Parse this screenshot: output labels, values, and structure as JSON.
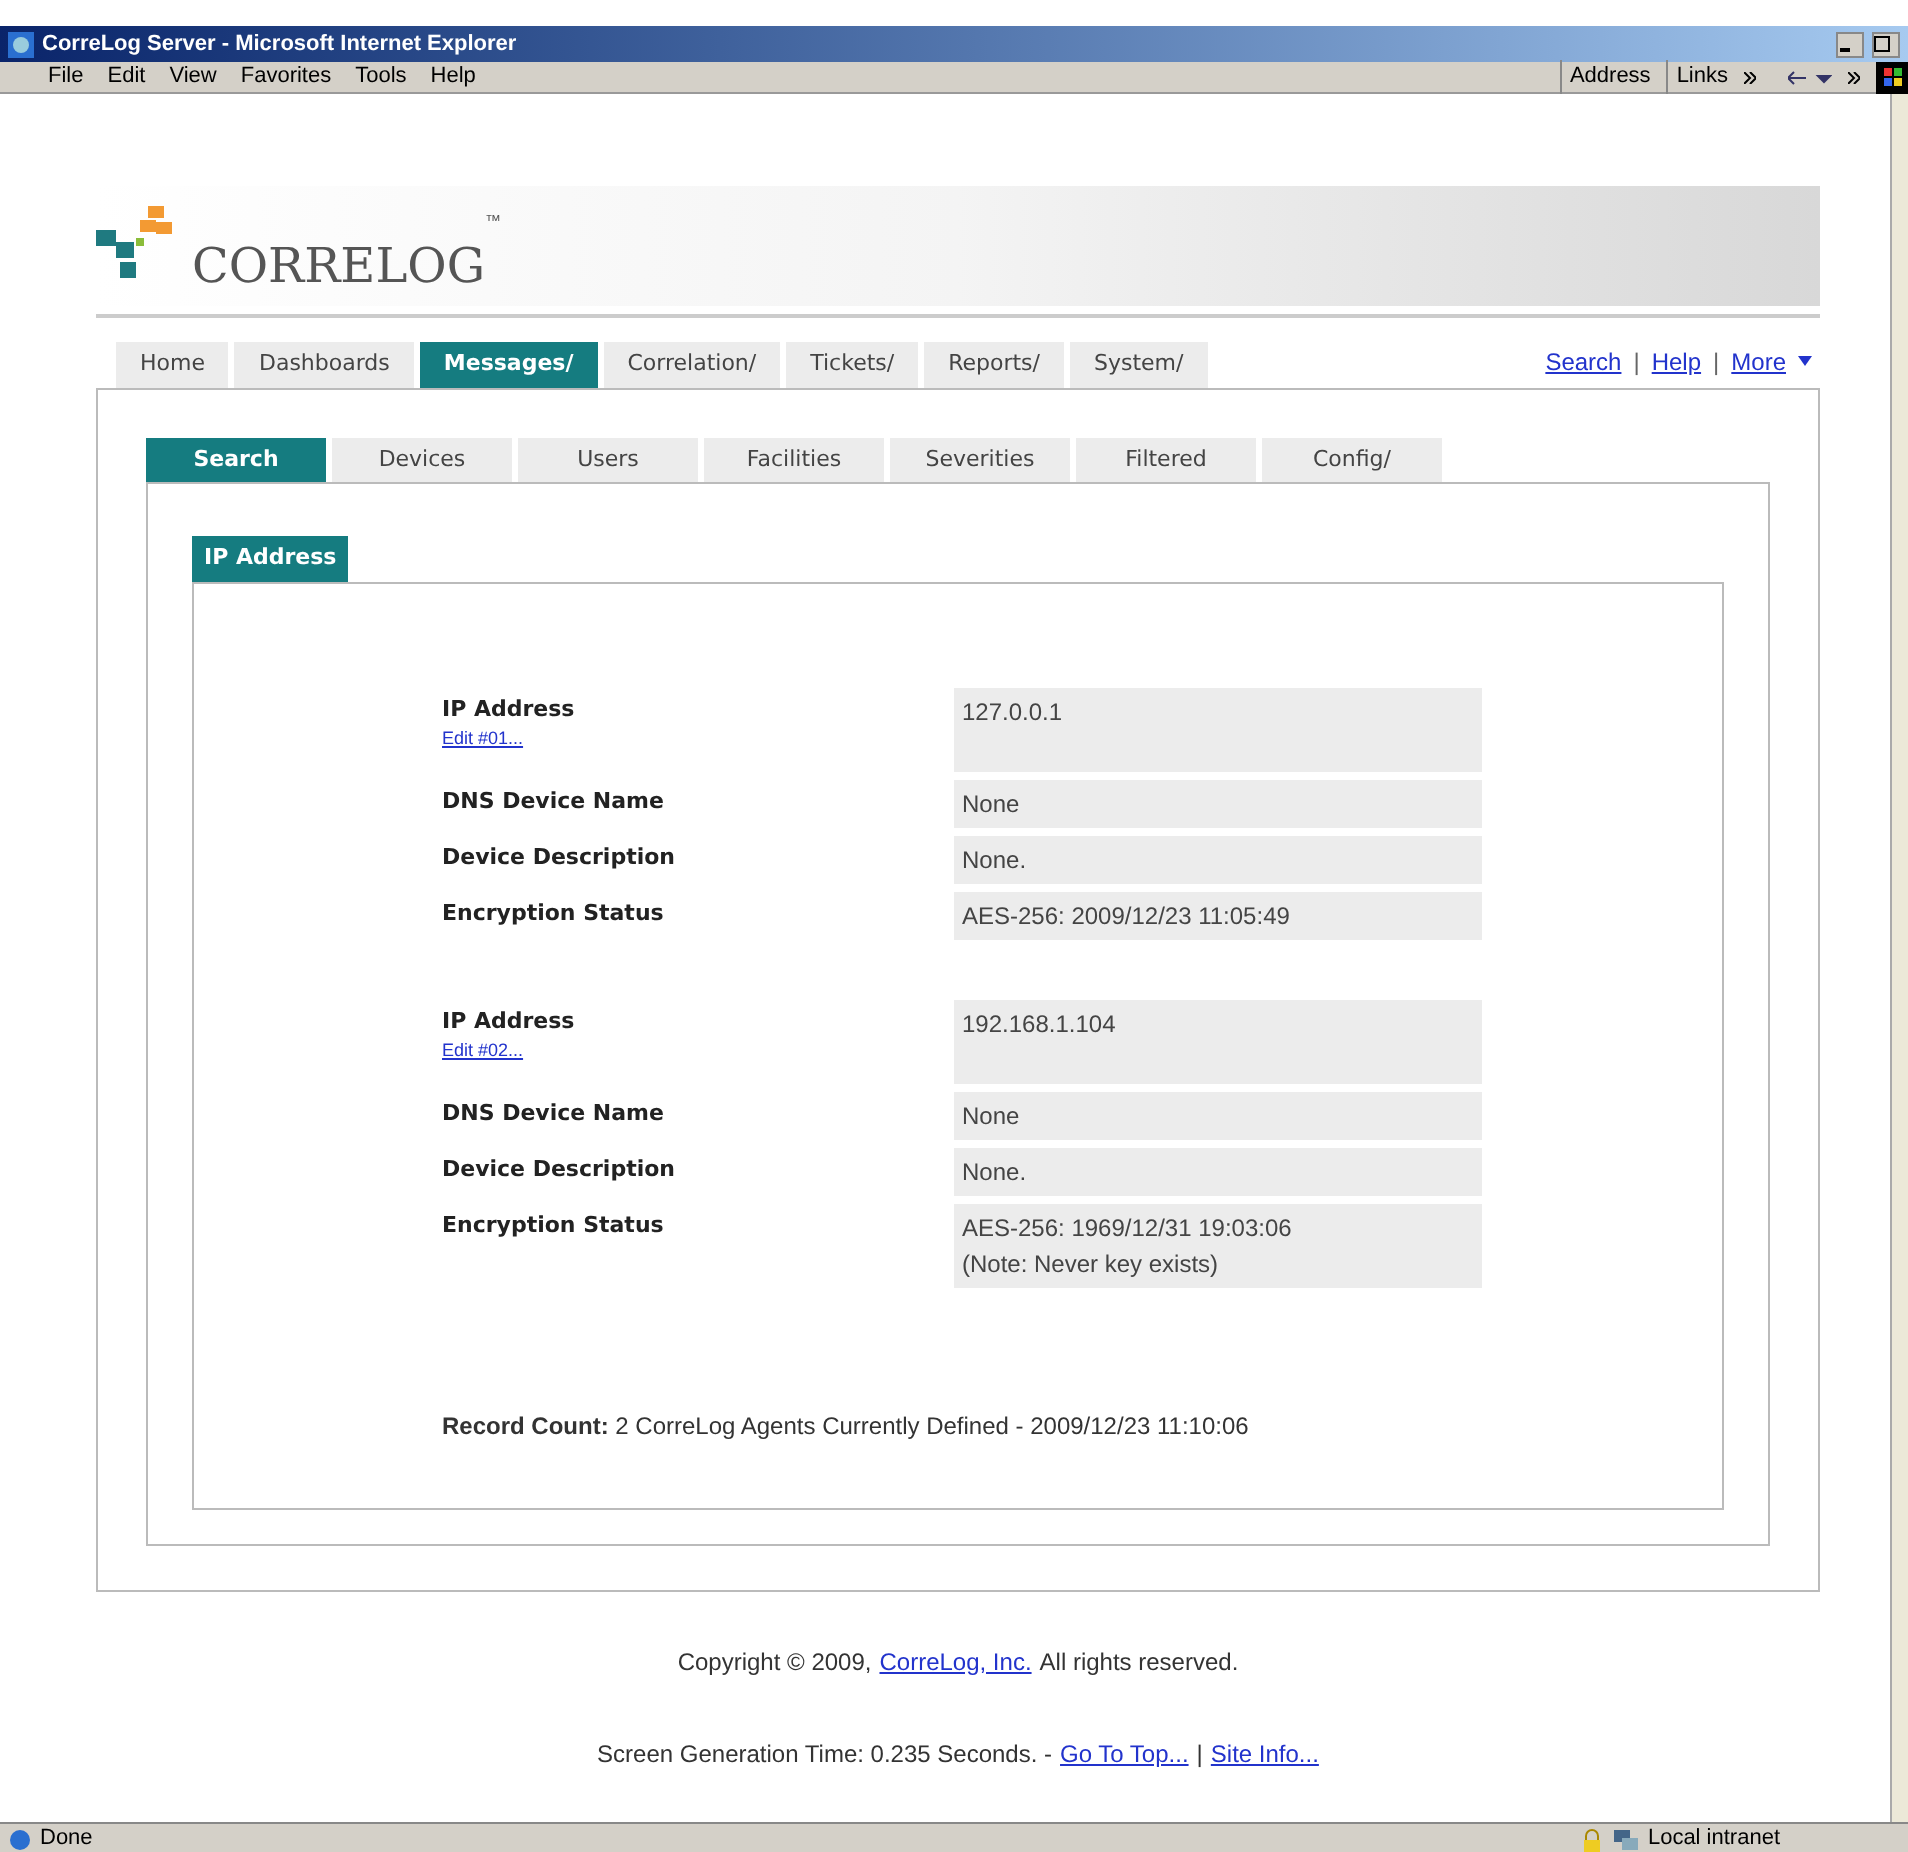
{
  "window": {
    "title": "CorreLog Server - Microsoft Internet Explorer"
  },
  "menu": [
    "File",
    "Edit",
    "View",
    "Favorites",
    "Tools",
    "Help"
  ],
  "toolbar": {
    "address": "Address",
    "links": "Links"
  },
  "logo": {
    "text": "CORRELOG",
    "tm": "™"
  },
  "nav_tabs": [
    {
      "label": "Home",
      "selected": false
    },
    {
      "label": "Dashboards",
      "selected": false
    },
    {
      "label": "Messages/",
      "selected": true
    },
    {
      "label": "Correlation/",
      "selected": false
    },
    {
      "label": "Tickets/",
      "selected": false
    },
    {
      "label": "Reports/",
      "selected": false
    },
    {
      "label": "System/",
      "selected": false
    }
  ],
  "nav_links": [
    {
      "kind": "link",
      "label": "Search"
    },
    {
      "kind": "separator",
      "label": "|"
    },
    {
      "kind": "link",
      "label": "Help"
    },
    {
      "kind": "separator",
      "label": "|"
    },
    {
      "kind": "menu",
      "label": "More"
    }
  ],
  "sub_tabs": [
    {
      "label": "Search",
      "selected": true
    },
    {
      "label": "Devices",
      "selected": false
    },
    {
      "label": "Users",
      "selected": false
    },
    {
      "label": "Facilities",
      "selected": false
    },
    {
      "label": "Severities",
      "selected": false
    },
    {
      "label": "Filtered",
      "selected": false
    },
    {
      "label": "Config/",
      "selected": false
    }
  ],
  "panel": {
    "title": "IP Address"
  },
  "records": [
    {
      "fields": [
        {
          "label": "IP Address",
          "link": "Edit #01...",
          "value": "127.0.0.1"
        },
        {
          "label": "DNS Device Name",
          "value": "None"
        },
        {
          "label": "Device Description",
          "value": "None."
        },
        {
          "label": "Encryption Status",
          "value": "AES-256: 2009/12/23 11:05:49"
        }
      ]
    },
    {
      "fields": [
        {
          "label": "IP Address",
          "link": "Edit #02...",
          "value": "192.168.1.104"
        },
        {
          "label": "DNS Device Name",
          "value": "None"
        },
        {
          "label": "Device Description",
          "value": "None."
        },
        {
          "label": "Encryption Status",
          "value": "AES-256: 1969/12/31 19:03:06",
          "note": "(Note: Never key exists)"
        }
      ]
    }
  ],
  "record_count": "**Record Count:** 2 CorreLog Agents Currently Defined - 2009/12/23 11:10:06",
  "footer": [
    [
      {
        "kind": "text",
        "label": "Copyright © 2009,"
      },
      {
        "kind": "link",
        "label": "CorreLog, Inc."
      },
      {
        "kind": "text",
        "label": "All rights reserved."
      }
    ],
    [
      {
        "kind": "text",
        "label": "Screen Generation Time: 0.235 Seconds. -"
      },
      {
        "kind": "link",
        "label": "Go To Top..."
      },
      {
        "kind": "text",
        "label": "|"
      },
      {
        "kind": "link",
        "label": "Site Info..."
      }
    ]
  ],
  "status_bar": {
    "status": "Done",
    "zone": "Local intranet"
  }
}
